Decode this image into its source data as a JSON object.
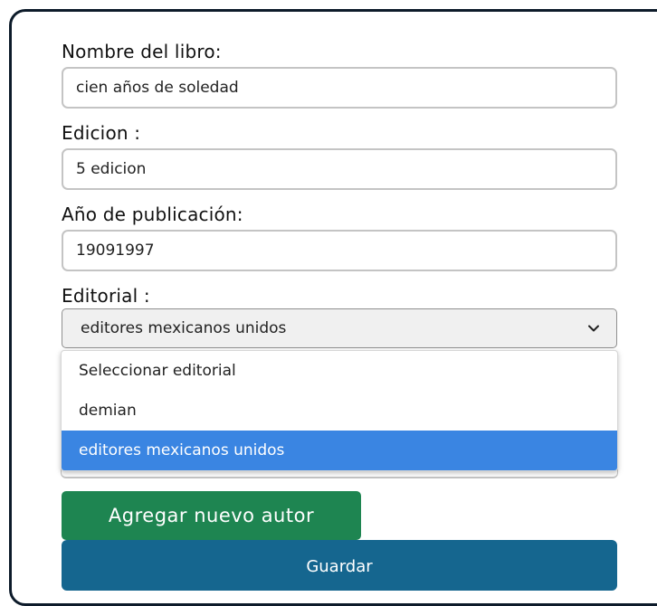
{
  "form": {
    "book_name_label": "Nombre del libro:",
    "book_name_value": "cien años de soledad",
    "edition_label": "Edicion :",
    "edition_value": "5 edicion",
    "year_label": "Año de publicación:",
    "year_value": "19091997",
    "publisher_label": "Editorial :",
    "publisher_selected": "editores mexicanos unidos",
    "publisher_options": [
      "Seleccionar editorial",
      "demian",
      "editores mexicanos unidos"
    ],
    "add_author_label": "Agregar nuevo autor",
    "save_label": "Guardar"
  },
  "icons": {
    "select_arrow": "chevron-down-icon"
  },
  "colors": {
    "card_border": "#0d1b2a",
    "selected_option": "#3a85e2",
    "add_button": "#1e8551",
    "save_button": "#15668f"
  }
}
